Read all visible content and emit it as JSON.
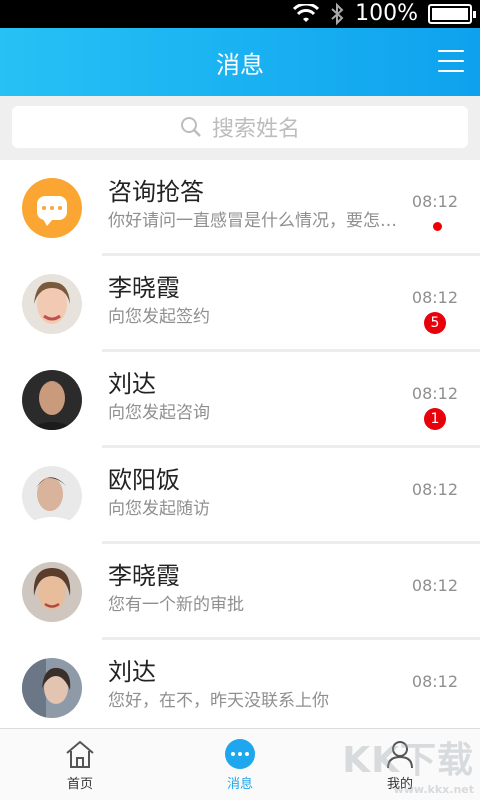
{
  "status_bar": {
    "battery_text": "100%",
    "battery_level": 1.0
  },
  "header": {
    "title": "消息",
    "menu_icon": "hamburger-menu-icon"
  },
  "search": {
    "placeholder": "搜索姓名",
    "icon": "search-icon"
  },
  "conversations": [
    {
      "name": "咨询抢答",
      "preview": "你好请问一直感冒是什么情况，要怎么办",
      "time": "08:12",
      "unread_dot": true,
      "badge": ""
    },
    {
      "name": "李晓霞",
      "preview": "向您发起签约",
      "time": "08:12",
      "unread_dot": false,
      "badge": "5"
    },
    {
      "name": "刘达",
      "preview": "向您发起咨询",
      "time": "08:12",
      "unread_dot": false,
      "badge": "1"
    },
    {
      "name": "欧阳饭",
      "preview": "向您发起随访",
      "time": "08:12",
      "unread_dot": false,
      "badge": ""
    },
    {
      "name": "李晓霞",
      "preview": "您有一个新的审批",
      "time": "08:12",
      "unread_dot": false,
      "badge": ""
    },
    {
      "name": "刘达",
      "preview": "您好，在不，昨天没联系上你",
      "time": "08:12",
      "unread_dot": false,
      "badge": ""
    }
  ],
  "tabbar": {
    "home": {
      "label": "首页",
      "icon": "home-icon"
    },
    "messages": {
      "label": "消息",
      "icon": "message-bubble-icon"
    },
    "me": {
      "label": "我的",
      "icon": "person-icon"
    }
  },
  "watermark": {
    "text": "KK下载",
    "sub": "www.kkx.net"
  },
  "colors": {
    "header_start": "#27c1f5",
    "header_end": "#0ea2ee",
    "accent": "#1ea6ee",
    "badge": "#e8000b",
    "consult_avatar": "#fba632"
  }
}
